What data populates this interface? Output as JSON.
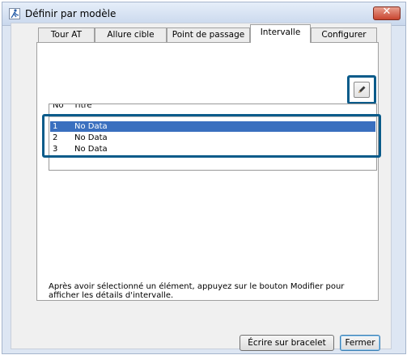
{
  "window": {
    "title": "Définir par modèle",
    "close_glyph": "✕"
  },
  "tabs": [
    {
      "label": "Tour AT"
    },
    {
      "label": "Allure cible"
    },
    {
      "label": "Point de passage"
    },
    {
      "label": "Intervalle"
    },
    {
      "label": "Configurer"
    }
  ],
  "active_tab": "Intervalle",
  "list": {
    "headers": {
      "no": "No",
      "title": "Titre"
    },
    "rows": [
      {
        "no": "1",
        "title": "No Data"
      },
      {
        "no": "2",
        "title": "No Data"
      },
      {
        "no": "3",
        "title": "No Data"
      }
    ],
    "selected_index": 0
  },
  "info_text": "Après avoir sélectionné un élément, appuyez sur le bouton Modifier pour afficher les détails d'intervalle.",
  "buttons": {
    "write": "Écrire sur bracelet",
    "close": "Fermer"
  },
  "icons": {
    "app": "runner-icon",
    "edit": "pencil-icon",
    "close": "close-icon"
  },
  "colors": {
    "selection": "#3a6fbf",
    "highlight": "#0a5b8a",
    "close_button": "#c8452f"
  }
}
